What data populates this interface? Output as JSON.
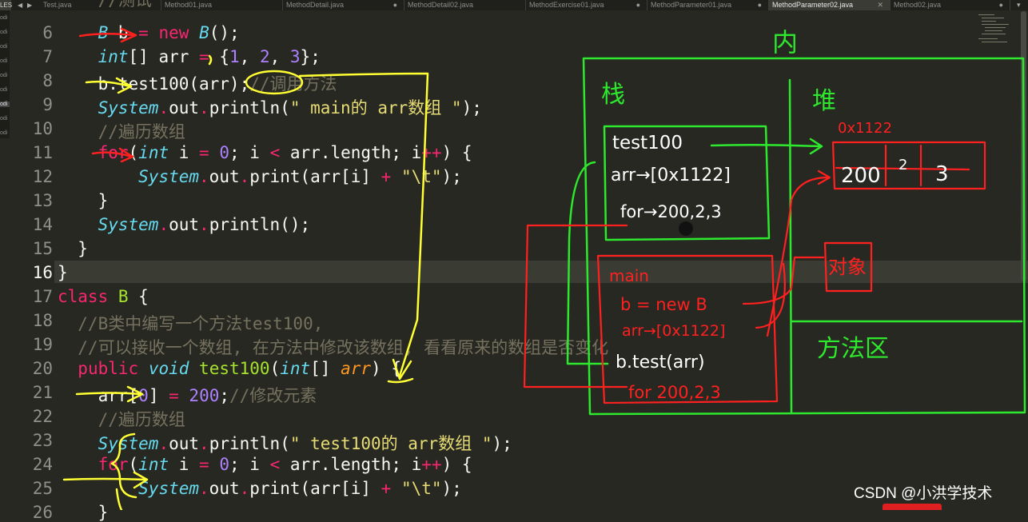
{
  "tabbar": {
    "corner": "LES",
    "tabs": [
      {
        "label": "Test.java",
        "modified": false
      },
      {
        "label": "Method01.java",
        "modified": false
      },
      {
        "label": "MethodDetail.java",
        "modified": true
      },
      {
        "label": "MethodDetail02.java",
        "modified": false
      },
      {
        "label": "MethodExercise01.java",
        "modified": true
      },
      {
        "label": "MethodParameter01.java",
        "modified": true
      },
      {
        "label": "MethodParameter02.java",
        "modified": false,
        "active": true
      },
      {
        "label": "Method02.java",
        "modified": true
      }
    ],
    "dirty_mark": "●",
    "close_mark": "✕"
  },
  "sidebar": {
    "items": [
      "odi",
      "odi",
      "odi",
      "odi",
      "odi",
      "odi",
      "odi",
      "odi",
      "odi"
    ]
  },
  "editor": {
    "current_line": "16",
    "lines": [
      {
        "no": "6"
      },
      {
        "no": "7"
      },
      {
        "no": "8"
      },
      {
        "no": "9"
      },
      {
        "no": "10"
      },
      {
        "no": "11"
      },
      {
        "no": "12"
      },
      {
        "no": "13"
      },
      {
        "no": "14"
      },
      {
        "no": "15"
      },
      {
        "no": "16"
      },
      {
        "no": "17"
      },
      {
        "no": "18"
      },
      {
        "no": "19"
      },
      {
        "no": "20"
      },
      {
        "no": "21"
      },
      {
        "no": "22"
      },
      {
        "no": "23"
      },
      {
        "no": "24"
      },
      {
        "no": "25"
      },
      {
        "no": "26"
      }
    ]
  },
  "annotations": {
    "memory_label": "内",
    "stack_label": "栈",
    "heap_label": "堆",
    "method_area_label": "方法区",
    "heap_address": "0x1122",
    "heap_array": [
      "200",
      "2",
      "3"
    ],
    "object_label": "对象",
    "frame_test100": [
      "test100",
      "arr→[0x1122]",
      "for→200,2,3"
    ],
    "frame_main": [
      "main",
      "b = new B",
      "arr→[0x1122]",
      "b.test(arr)",
      "for 200,2,3"
    ]
  },
  "colors": {
    "background": "#272822",
    "keyword": "#f92672",
    "type": "#66d9ef",
    "class": "#a6e22e",
    "number": "#ae81ff",
    "string": "#e6db74",
    "comment": "#75715e",
    "param": "#fd971f",
    "ink_green": "#2ee82e",
    "ink_red": "#ff2020",
    "ink_yellow": "#ffff33"
  },
  "watermark": "CSDN @小洪学技术"
}
